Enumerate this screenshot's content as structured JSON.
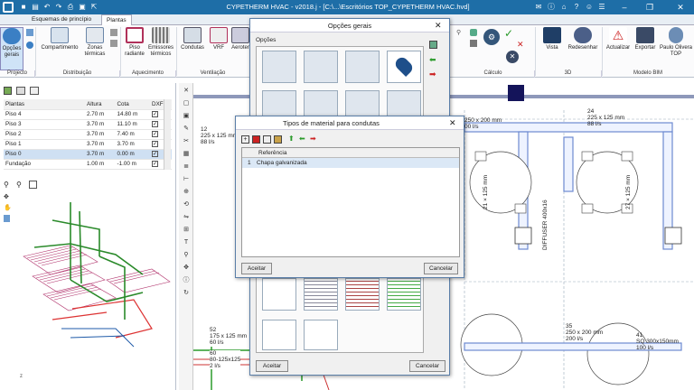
{
  "window": {
    "title": "CYPETHERM HVAC - v2018.j - [C:\\...\\Escritórios TOP_CYPETHERM HVAC.hvd]",
    "minimize": "‒",
    "maximize": "❐",
    "close": "✕"
  },
  "tabs": [
    "Esquemas de princípio",
    "Plantas"
  ],
  "ribbon": {
    "buttons": {
      "opcoes": "Opções gerais",
      "compartimento": "Compartimento",
      "zonas": "Zonas térmicas",
      "piso_radiante": "Piso radiante",
      "emissores": "Emissores térmicos",
      "condutas": "Condutas",
      "vrf": "VRF",
      "aerotermia": "Aeroter",
      "vista": "Vista",
      "redesenhar": "Redesenhar",
      "actualizar": "Actualizar",
      "exportar": "Exportar",
      "user": "Paulo Olivera TOP"
    },
    "groups": {
      "projecto": "Projecto",
      "distribuicao": "Distribuição",
      "aquecimento": "Aquecimento",
      "ventilacao": "Ventilação",
      "calculo": "Cálculo",
      "tres_d": "3D",
      "bim": "Modelo BIM"
    }
  },
  "floors": {
    "headers": [
      "Plantas",
      "Altura",
      "Cota",
      "DXF"
    ],
    "rows": [
      {
        "name": "Piso 4",
        "altura": "2.70 m",
        "cota": "14.80 m"
      },
      {
        "name": "Piso 3",
        "altura": "3.70 m",
        "cota": "11.10 m"
      },
      {
        "name": "Piso 2",
        "altura": "3.70 m",
        "cota": "7.40 m"
      },
      {
        "name": "Piso 1",
        "altura": "3.70 m",
        "cota": "3.70 m"
      },
      {
        "name": "Piso 0",
        "altura": "3.70 m",
        "cota": "0.00 m"
      },
      {
        "name": "Fundação",
        "altura": "1.00 m",
        "cota": "-1.00 m"
      }
    ]
  },
  "canvas_labels": {
    "l1": "12",
    "l1b": "225 x 125 mm",
    "l1c": "88 l/s",
    "l2": "24",
    "l2b": "225 x 125 mm",
    "l2c": "88 l/s",
    "l3": "250 x 200 mm",
    "l3b": "00 l/s",
    "v1": "21 × 125 mm",
    "v2": "27 × 125 mm",
    "diff": "DIFFUSER 400x16",
    "b1": "35",
    "b1b": "250 x 200 mm",
    "b1c": "200 l/s",
    "b2": "41",
    "b2b": "SQ 300x150mm",
    "b2c": "100 l/s",
    "b3": "52",
    "b3b": "175 x 125 mm",
    "b3c": "60 l/s",
    "b4": "60",
    "b4b": "80-125x125",
    "b4c": "2 l/s"
  },
  "opcoes_dialog": {
    "title": "Opções gerais",
    "section": "Opções",
    "ok": "Aceitar",
    "cancel": "Cancelar"
  },
  "material_dialog": {
    "title": "Tipos de material para condutas",
    "col_header": "Referência",
    "row_index": "1",
    "row_value": "Chapa galvanizada",
    "ok": "Aceitar",
    "cancel": "Cancelar"
  }
}
